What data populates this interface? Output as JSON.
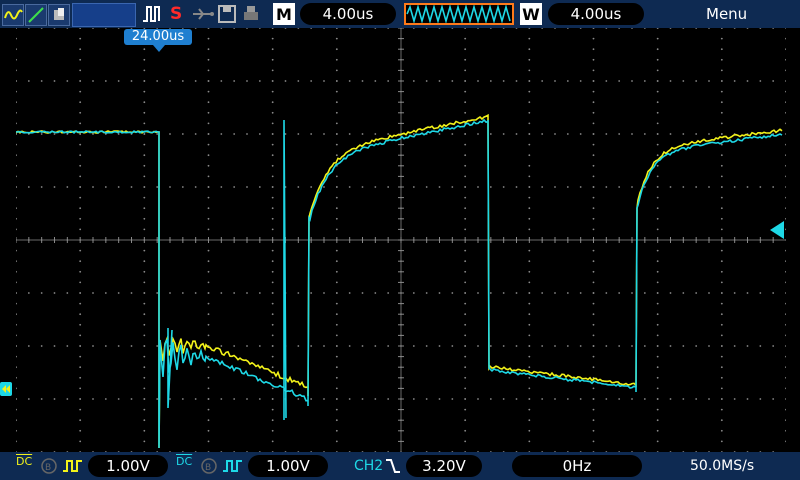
{
  "colors": {
    "ch1": "#f2f21a",
    "ch2": "#1ed8e6",
    "accent_orange": "#ff7a1a",
    "bar_bg": "#0e2a52",
    "badge_bg": "#1f7fd0"
  },
  "toolbar": {
    "icons": [
      "waveform-icon",
      "line-icon",
      "persistence-icon",
      "run-stop-box",
      "trigger-edge-icon",
      "stop-indicator-icon",
      "usb-icon",
      "save-icon",
      "printer-icon"
    ],
    "stop_label": "S",
    "mode_label": "M",
    "timebase": "4.00us",
    "window_label": "W",
    "window_timebase": "4.00us",
    "menu_label": "Menu"
  },
  "trigger_badge": "24.00us",
  "statusbar": {
    "ch1_coupling": "DC",
    "ch1_scale": "1.00V",
    "ch2_coupling": "DC",
    "ch2_scale": "1.00V",
    "trigger_source": "CH2",
    "trigger_level": "3.20V",
    "frequency": "0Hz",
    "sample_rate": "50.0MS/s"
  }
}
